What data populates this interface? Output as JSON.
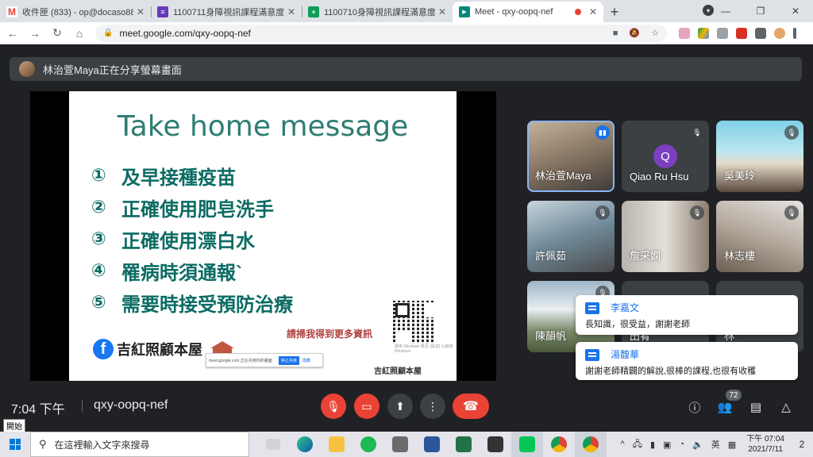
{
  "browser": {
    "tabs": [
      {
        "title": "收件匣 (833) - op@docaso885...",
        "favicon": "M",
        "fav_color": "#ea4335",
        "active": false
      },
      {
        "title": "1100711身障視訊課程滿意度調...",
        "favicon": "≡",
        "fav_color": "#673ab7",
        "active": false
      },
      {
        "title": "1100710身障視訊課程滿意度調...",
        "favicon": "+",
        "fav_color": "#0f9d58",
        "active": false
      },
      {
        "title": "Meet - qxy-oopq-nef",
        "favicon": "▶",
        "fav_color": "#00897b",
        "active": true
      }
    ],
    "url": "meet.google.com/qxy-oopq-nef"
  },
  "meet": {
    "share_banner": "林治萱Maya正在分享螢幕畫面",
    "slide": {
      "title": "Take home message",
      "items": [
        {
          "num": "①",
          "text": "及早接種疫苗"
        },
        {
          "num": "②",
          "text": "正確使用肥皂洗手"
        },
        {
          "num": "③",
          "text": "正確使用漂白水"
        },
        {
          "num": "④",
          "text": "罹病時須通報`"
        },
        {
          "num": "⑤",
          "text": "需要時接受預防治療"
        }
      ],
      "scan_text": "請掃我得到更多資訊",
      "brand": "吉紅照顧本屋",
      "brand_small": "吉紅照顧本屋",
      "popup_text": "meet.google.com 正在共用你的畫面",
      "popup_stop": "停止共用",
      "popup_hide": "隱藏",
      "watermark": "啟用 Windows 移至 [設定] 以啟用 Windows"
    },
    "participants": [
      {
        "name": "林治萱Maya",
        "speaking": true
      },
      {
        "name": "Qiao Ru Hsu",
        "initial": "Q"
      },
      {
        "name": "吳美玲"
      },
      {
        "name": "許佩茹"
      },
      {
        "name": "詹采嫻"
      },
      {
        "name": "林志樓"
      },
      {
        "name": "陳韻帆"
      },
      {
        "name": "田肴"
      },
      {
        "name": "林"
      }
    ],
    "chat_notifications": [
      {
        "sender": "李嘉文",
        "message": "長知識，很受益，謝謝老師"
      },
      {
        "sender": "湯馥華",
        "message": "謝謝老師精闢的解說,很棒的課程,也很有收穫"
      }
    ],
    "controls": {
      "time": "7:04 下午",
      "meeting_code": "qxy-oopq-nef",
      "participant_count": "72"
    }
  },
  "taskbar": {
    "start_tooltip": "開始",
    "search_placeholder": "在這裡輸入文字來搜尋",
    "time": "下午 07:04",
    "date": "2021/7/11",
    "notification_count": "2"
  },
  "colors": {
    "meet_bg": "#202124",
    "danger": "#ea4335",
    "slide_title": "#2e7d73",
    "accent": "#1a73e8"
  }
}
